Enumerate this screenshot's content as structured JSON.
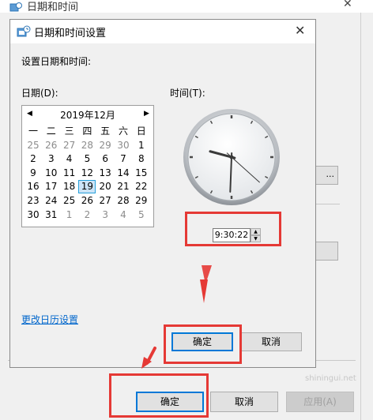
{
  "outer_window": {
    "title": "日期和时间",
    "close_glyph": "✕",
    "ellipsis_label": "..."
  },
  "dialog": {
    "title": "日期和时间设置",
    "close_glyph": "✕",
    "set_label": "设置日期和时间:",
    "date_label": "日期(D):",
    "time_label": "时间(T):",
    "calendar": {
      "month": "2019年12月",
      "prev_glyph": "◀",
      "next_glyph": "▶",
      "weekdays": [
        "一",
        "二",
        "三",
        "四",
        "五",
        "六",
        "日"
      ],
      "weeks": [
        [
          "25",
          "26",
          "27",
          "28",
          "29",
          "30",
          "1"
        ],
        [
          "2",
          "3",
          "4",
          "5",
          "6",
          "7",
          "8"
        ],
        [
          "9",
          "10",
          "11",
          "12",
          "13",
          "14",
          "15"
        ],
        [
          "16",
          "17",
          "18",
          "19",
          "20",
          "21",
          "22"
        ],
        [
          "23",
          "24",
          "25",
          "26",
          "27",
          "28",
          "29"
        ],
        [
          "30",
          "31",
          "1",
          "2",
          "3",
          "4",
          "5"
        ]
      ],
      "selected": "19"
    },
    "time_value": "9:30:22",
    "clock": {
      "hours": 9,
      "minutes": 30,
      "seconds": 22
    },
    "calendar_link": "更改日历设置",
    "ok_label": "确定",
    "cancel_label": "取消"
  },
  "footer": {
    "ok_label": "确定",
    "cancel_label": "取消",
    "apply_label": "应用(A)"
  },
  "watermark": "shiningui.net"
}
